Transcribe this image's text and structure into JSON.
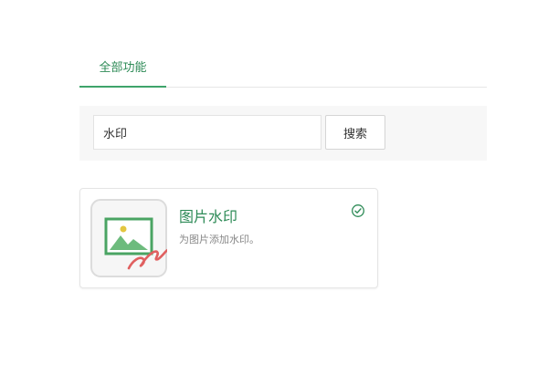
{
  "tabs": [
    {
      "label": "全部功能",
      "active": true
    }
  ],
  "search": {
    "value": "水印",
    "button_label": "搜索"
  },
  "apps": [
    {
      "title": "图片水印",
      "description": "为图片添加水印。",
      "icon": "image-watermark-icon",
      "status_icon": "check-circle-icon"
    }
  ],
  "colors": {
    "accent": "#3ea46b",
    "title_text": "#2e8b57",
    "panel_background": "#f7f7f7",
    "signature_red": "#e06060",
    "check_green": "#2e8b57"
  }
}
